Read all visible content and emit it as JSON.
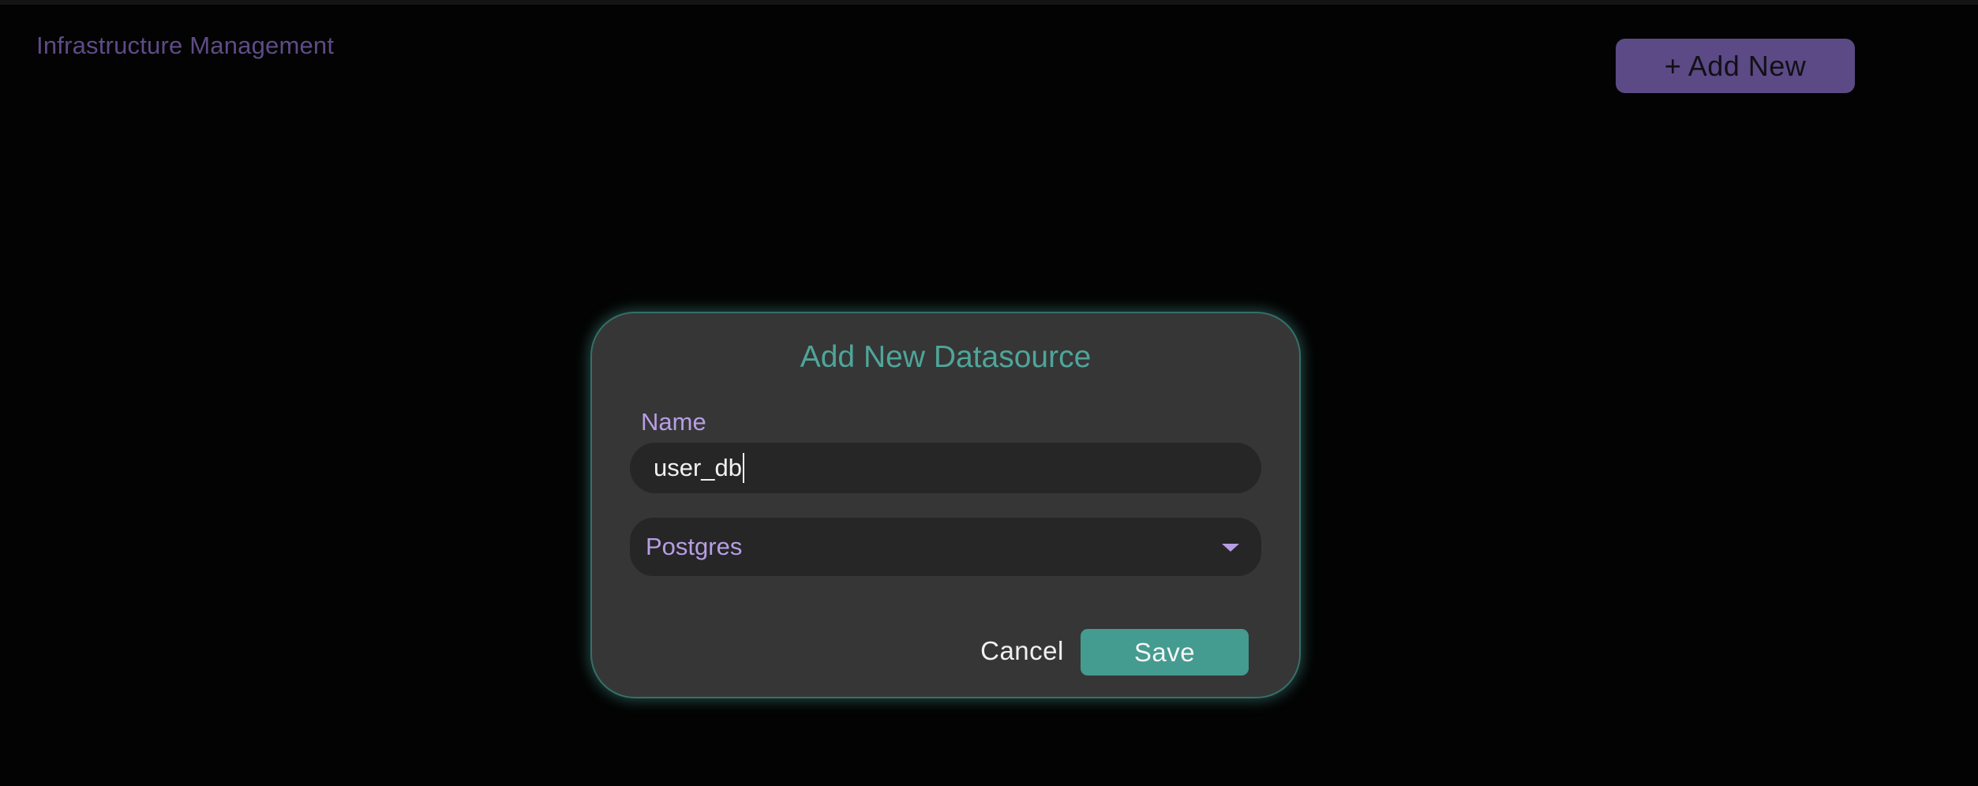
{
  "app": {
    "title": "Infrastructure Management"
  },
  "header": {
    "add_new_label": "+ Add New"
  },
  "dialog": {
    "title": "Add New Datasource",
    "name_label": "Name",
    "name_value": "user_db",
    "type_value": "Postgres",
    "cancel_label": "Cancel",
    "save_label": "Save"
  },
  "icons": {
    "select_chevron": "chevron-down-icon"
  },
  "colors": {
    "background": "#030303",
    "accent_purple": "#5b4a85",
    "label_purple": "#b79ee4",
    "accent_teal": "#449b90",
    "dialog_bg": "#363636"
  }
}
